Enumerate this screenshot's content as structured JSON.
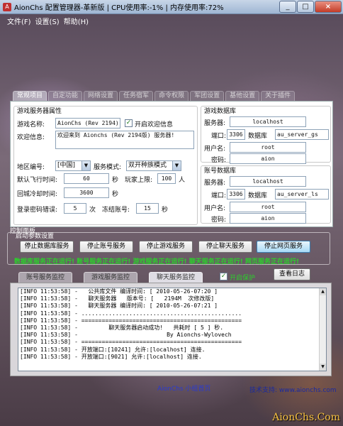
{
  "window": {
    "title": "AionChs 配置管理器-革新版 | CPU使用率:-1% | 内存使用率:72%",
    "min": "_",
    "max": "□",
    "close": "×"
  },
  "menu": [
    "文件(F)",
    "设置(S)",
    "帮助(H)"
  ],
  "top_tabs": [
    "常规项目",
    "自定功能",
    "网络设置",
    "任务宿军",
    "命令权限",
    "军团设置",
    "基他设置",
    "关于插件"
  ],
  "game_server": {
    "group_title": "游戏服务器属性",
    "name_label": "游戏名称:",
    "name_value": "AionChs (Rev 2194)",
    "welcome_checkbox_label": "开启欢迎信息",
    "welcome_label": "欢迎信息:",
    "welcome_value": "欢迎来到 Aionchs (Rev 2194版) 服务器!",
    "region_label": "地区编号:",
    "region_value": "[中国]",
    "mode_label": "服务模式:",
    "mode_value": "双开种族模式",
    "flight_label": "默认飞行时间:",
    "flight_value": "60",
    "flight_unit": "秒",
    "player_limit_label": "玩家上限:",
    "player_limit_value": "100",
    "player_limit_unit": "人",
    "return_label": "回城冷却时间:",
    "return_value": "3600",
    "return_unit": "秒",
    "login_error_label": "登录密码错误:",
    "login_error_value": "5",
    "login_error_unit": "次",
    "freeze_label": "冻结账号:",
    "freeze_value": "15",
    "freeze_unit": "秒"
  },
  "game_db": {
    "group_title": "游戏数据库",
    "server_label": "服务器:",
    "server_value": "localhost",
    "port_label": "端口:",
    "port_value": "3306",
    "db_label": "数据库",
    "db_value": "au_server_gs",
    "user_label": "用户名:",
    "user_value": "root",
    "pass_label": "密码:",
    "pass_value": "aion"
  },
  "account_db": {
    "group_title": "账号数据库",
    "server_label": "服务器:",
    "server_value": "localhost",
    "port_label": "端口:",
    "port_value": "3306",
    "db_label": "数据库",
    "db_value": "au_server_ls",
    "user_label": "用户名:",
    "user_value": "root",
    "pass_label": "密码:",
    "pass_value": "aion"
  },
  "control": {
    "panel_title": "控制面板",
    "startup_title": "启动参数设置",
    "buttons": [
      "停止数据库服务",
      "停止账号服务",
      "停止游戏服务",
      "停止聊天服务",
      "停止网页服务"
    ],
    "status": "数据库服务正在运行! 账号服务正在运行! 游戏服务正在运行! 聊天服务正在运行! 网页服务正在运行!"
  },
  "monitor_tabs": [
    "账号服务监控",
    "游戏服务监控",
    "聊天服务监控"
  ],
  "protect_label": "开启保护",
  "view_log": "查看日志",
  "log_lines": [
    "[INFO 11:53:58] -   公共库文件 编译时间: [ 2010-05-26-07:20 ]",
    "[INFO 11:53:58] -   聊天服务器   版本号: [   2194M  次修改版]",
    "[INFO 11:53:58] -   聊天服务器 编译时间: [ 2010-05-26-07:21 ]",
    "[INFO 11:53:58] - ...............................................",
    "[INFO 11:53:58] - ===============================================",
    "[INFO 11:53:58] -         聊天服务器启动成功!   共耗时 [ 5 ] 秒.",
    "[INFO 11:53:58] -                          By Aionchs-Wylovech",
    "[INFO 11:53:58] - ===============================================",
    "[INFO 11:53:58] - 开放端口:[10241] 允许:[localhost] 连接.",
    "[INFO 11:53:58] - 开放端口:[9021] 允许:[localhost] 连接."
  ],
  "footer": {
    "home": "AionChs 小组首页",
    "support": "技术支持: www.aionchs.com"
  },
  "watermark": "AionChs.Com"
}
